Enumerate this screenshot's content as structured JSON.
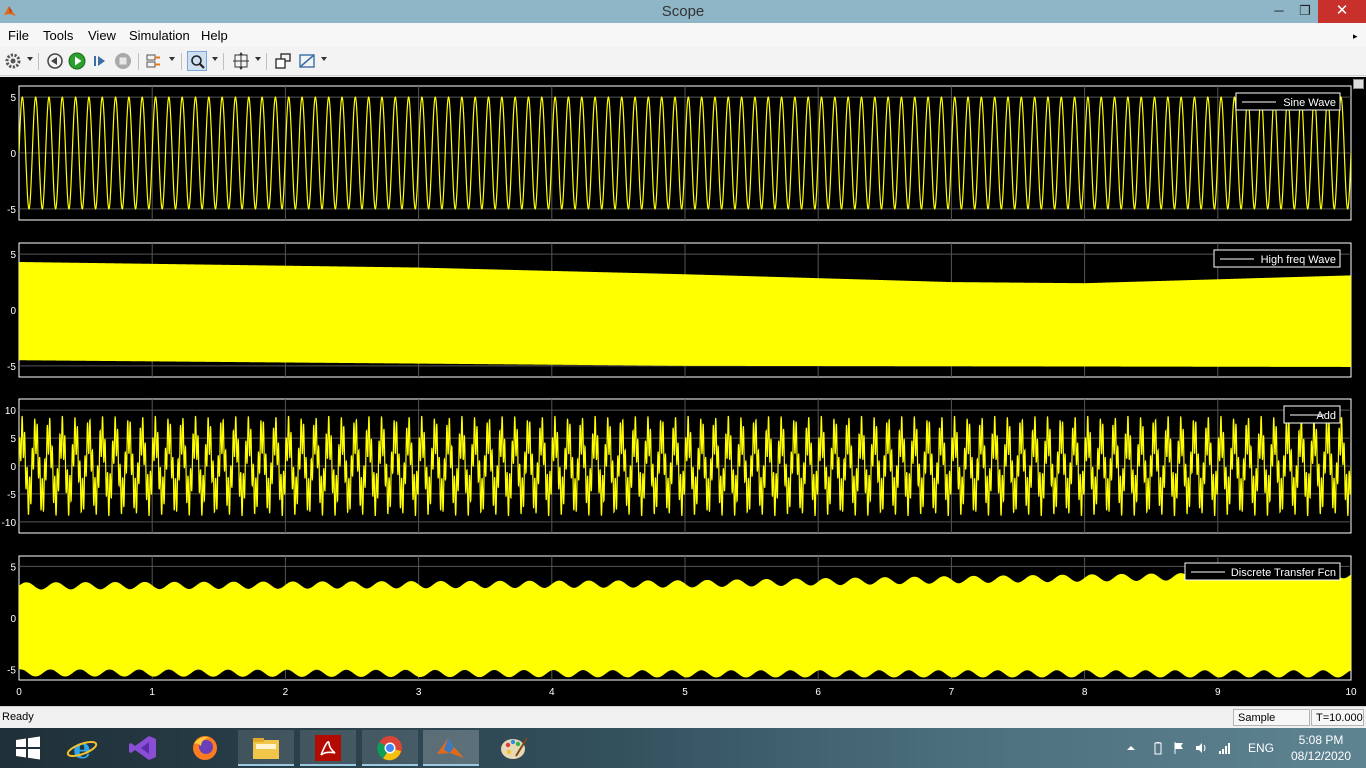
{
  "window": {
    "title": "Scope",
    "minimize": "─",
    "restore": "❐",
    "close": "✕"
  },
  "menu": [
    "File",
    "Tools",
    "View",
    "Simulation",
    "Help"
  ],
  "toolbar": {
    "icons": [
      "settings-gear-icon",
      "step-back-icon",
      "run-icon",
      "step-forward-icon",
      "stop-icon",
      "signal-selector-icon",
      "zoom-icon",
      "autoscale-icon",
      "restore-view-icon",
      "measure-icon"
    ],
    "accent": "#3a7bd5"
  },
  "scope": {
    "background": "#000000",
    "axes_color": "#ffffff",
    "grid_color": "#555555",
    "trace_color": "#ffff00",
    "x_ticks": [
      "0",
      "1",
      "2",
      "3",
      "4",
      "5",
      "6",
      "7",
      "8",
      "9",
      "10"
    ]
  },
  "chart_data": [
    {
      "type": "line",
      "legend": "Sine Wave",
      "xlim": [
        0,
        10
      ],
      "ylim": [
        -6,
        6
      ],
      "y_ticks": [
        "5",
        "0",
        "-5"
      ],
      "y_tick_values": [
        5,
        0,
        -5
      ],
      "series": [
        {
          "name": "Sine Wave",
          "amplitude": 5,
          "cycles": 100
        }
      ],
      "grid": true
    },
    {
      "type": "line",
      "legend": "High freq Wave",
      "xlim": [
        0,
        10
      ],
      "ylim": [
        -6,
        6
      ],
      "y_ticks": [
        "5",
        "0",
        "-5"
      ],
      "y_tick_values": [
        5,
        0,
        -5
      ],
      "series": [
        {
          "name": "High freq Wave",
          "upper_envelope": {
            "x": [
              0,
              3,
              5,
              7,
              8,
              10
            ],
            "y": [
              4.3,
              3.8,
              3.2,
              2.5,
              2.4,
              3.1
            ]
          },
          "lower_envelope": {
            "x": [
              0,
              5,
              10
            ],
            "y": [
              -4.5,
              -5.0,
              -5.1
            ]
          }
        }
      ],
      "grid": true
    },
    {
      "type": "line",
      "legend": "Add",
      "xlim": [
        0,
        10
      ],
      "ylim": [
        -12,
        12
      ],
      "y_ticks": [
        "10",
        "5",
        "0",
        "-5",
        "-10"
      ],
      "y_tick_values": [
        10,
        5,
        0,
        -5,
        -10
      ],
      "series": [
        {
          "name": "Add",
          "amplitude": 9,
          "cycles": 100
        }
      ],
      "grid": true
    },
    {
      "type": "line",
      "legend": "Discrete Transfer Fcn",
      "xlim": [
        0,
        10
      ],
      "ylim": [
        -6,
        6
      ],
      "y_ticks": [
        "5",
        "0",
        "-5"
      ],
      "y_tick_values": [
        5,
        0,
        -5
      ],
      "series": [
        {
          "name": "Discrete Transfer Fcn",
          "upper_envelope": {
            "x": [
              0,
              5,
              7,
              10
            ],
            "y": [
              3.1,
              3.3,
              3.7,
              4.2
            ]
          },
          "lower_envelope": {
            "x": [
              0,
              5,
              10
            ],
            "y": [
              -5.3,
              -5.4,
              -5.4
            ]
          }
        }
      ],
      "grid": true
    }
  ],
  "status": {
    "text": "Ready",
    "sample_mode": "Sample based",
    "time": "T=10.000"
  },
  "taskbar": {
    "apps": [
      "windows-start-icon",
      "internet-explorer-icon",
      "visual-studio-icon",
      "firefox-icon",
      "file-explorer-icon",
      "acrobat-icon",
      "chrome-icon",
      "matlab-icon",
      "paint-icon"
    ],
    "language": "ENG",
    "time": "5:08 PM",
    "date": "08/12/2020"
  }
}
